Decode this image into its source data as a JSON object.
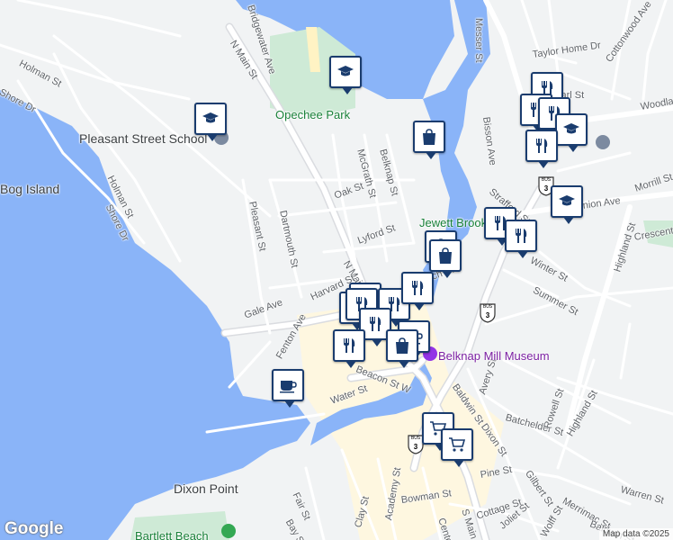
{
  "map": {
    "copyright": "Map data ©2025",
    "logo_text": "Google",
    "colors": {
      "land": "#f1f3f4",
      "water": "#8ab4f8",
      "road": "#ffffff",
      "road_major": "#dadce0",
      "park": "#ceead6",
      "commercial": "#fef7e0",
      "marker": "#1a3c6e"
    },
    "street_labels": [
      {
        "text": "Bridgewater Ave"
      },
      {
        "text": "N Main St"
      },
      {
        "text": "Holman St"
      },
      {
        "text": "Shore Dr"
      },
      {
        "text": "Holman St"
      },
      {
        "text": "Shore Dr"
      },
      {
        "text": "Pleasant St"
      },
      {
        "text": "Dartmouth St"
      },
      {
        "text": "McGrath St"
      },
      {
        "text": "Belknap St"
      },
      {
        "text": "Oak St"
      },
      {
        "text": "Lyford St"
      },
      {
        "text": "N Main St"
      },
      {
        "text": "Harvard St"
      },
      {
        "text": "Gale Ave"
      },
      {
        "text": "Fenton Ave"
      },
      {
        "text": "Church St"
      },
      {
        "text": "Messer St"
      },
      {
        "text": "Taylor Home Dr"
      },
      {
        "text": "Cottonwood Ave"
      },
      {
        "text": "Bisson Ave"
      },
      {
        "text": "Pearl St"
      },
      {
        "text": "Woodland"
      },
      {
        "text": "Strafford St"
      },
      {
        "text": "Union Ave"
      },
      {
        "text": "Morrill St"
      },
      {
        "text": "Crescent"
      },
      {
        "text": "Highland St"
      },
      {
        "text": "Winter St"
      },
      {
        "text": "Summer St"
      },
      {
        "text": "Beacon St W"
      },
      {
        "text": "Water St"
      },
      {
        "text": "Avery St"
      },
      {
        "text": "Batchelder St"
      },
      {
        "text": "Rowell St"
      },
      {
        "text": "Highland St"
      },
      {
        "text": "Baldwin St"
      },
      {
        "text": "Dixon St"
      },
      {
        "text": "Gilbert St"
      },
      {
        "text": "Merrimac St"
      },
      {
        "text": "Warren St"
      },
      {
        "text": "Pine St"
      },
      {
        "text": "Cottage St"
      },
      {
        "text": "Joliet St"
      },
      {
        "text": "Wolff St"
      },
      {
        "text": "Baldwin St"
      },
      {
        "text": "Bowman St"
      },
      {
        "text": "Academy St"
      },
      {
        "text": "Clay St"
      },
      {
        "text": "Center St"
      },
      {
        "text": "S Main St"
      },
      {
        "text": "Fair St"
      },
      {
        "text": "Bay St"
      }
    ],
    "place_labels": [
      {
        "text": "Opechee Park",
        "kind": "park"
      },
      {
        "text": "Pleasant Street School",
        "kind": "place"
      },
      {
        "text": "Belknap Mill Museum",
        "kind": "museum"
      },
      {
        "text": "Jewett Brook",
        "kind": "park"
      },
      {
        "text": "Dixon Point",
        "kind": "place"
      },
      {
        "text": "Bartlett Beach",
        "kind": "park"
      },
      {
        "text": "Bog Island",
        "kind": "place"
      }
    ],
    "route_shields": [
      {
        "number": "3",
        "type": "BUS"
      },
      {
        "number": "3",
        "type": "BUS"
      },
      {
        "number": "3",
        "type": "BUS"
      }
    ],
    "markers": [
      {
        "icon": "school"
      },
      {
        "icon": "school"
      },
      {
        "icon": "shopping-bag"
      },
      {
        "icon": "restaurant"
      },
      {
        "icon": "restaurant"
      },
      {
        "icon": "restaurant"
      },
      {
        "icon": "school"
      },
      {
        "icon": "restaurant"
      },
      {
        "icon": "school"
      },
      {
        "icon": "restaurant"
      },
      {
        "icon": "restaurant"
      },
      {
        "icon": "shopping-bag"
      },
      {
        "icon": "shopping-bag"
      },
      {
        "icon": "restaurant"
      },
      {
        "icon": "restaurant"
      },
      {
        "icon": "restaurant"
      },
      {
        "icon": "restaurant"
      },
      {
        "icon": "restaurant"
      },
      {
        "icon": "coffee"
      },
      {
        "icon": "restaurant"
      },
      {
        "icon": "shopping-bag"
      },
      {
        "icon": "coffee"
      },
      {
        "icon": "shopping-cart"
      },
      {
        "icon": "shopping-cart"
      },
      {
        "icon": "restaurant"
      }
    ]
  }
}
